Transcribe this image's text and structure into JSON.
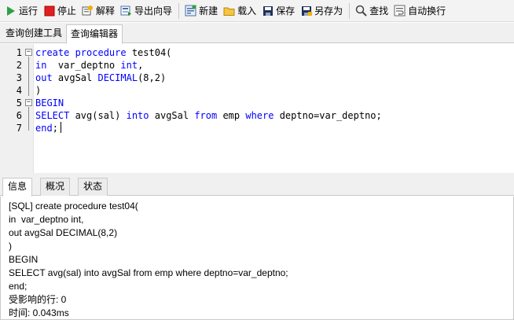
{
  "toolbar": {
    "buttons": [
      {
        "name": "run",
        "label": "运行",
        "icon": "play-icon"
      },
      {
        "name": "stop",
        "label": "停止",
        "icon": "stop-icon"
      },
      {
        "name": "explain",
        "label": "解释",
        "icon": "explain-icon"
      },
      {
        "name": "export-wizard",
        "label": "导出向导",
        "icon": "export-icon"
      },
      {
        "name": "new",
        "label": "新建",
        "icon": "new-icon"
      },
      {
        "name": "load",
        "label": "载入",
        "icon": "folder-icon"
      },
      {
        "name": "save",
        "label": "保存",
        "icon": "save-icon"
      },
      {
        "name": "save-as",
        "label": "另存为",
        "icon": "save-as-icon"
      },
      {
        "name": "find",
        "label": "查找",
        "icon": "search-icon"
      },
      {
        "name": "wrap",
        "label": "自动换行",
        "icon": "wrap-icon"
      }
    ]
  },
  "top_tabs": [
    {
      "label": "查询创建工具",
      "active": false
    },
    {
      "label": "查询编辑器",
      "active": true
    }
  ],
  "editor": {
    "line_numbers": [
      "1",
      "2",
      "3",
      "4",
      "5",
      "6",
      "7"
    ],
    "lines": [
      [
        {
          "t": "create procedure ",
          "k": true
        },
        {
          "t": "test04(",
          "k": false
        }
      ],
      [
        {
          "t": "in",
          "k": true
        },
        {
          "t": "  var_deptno ",
          "k": false
        },
        {
          "t": "int",
          "k": true
        },
        {
          "t": ",",
          "k": false
        }
      ],
      [
        {
          "t": "out",
          "k": true
        },
        {
          "t": " avgSal ",
          "k": false
        },
        {
          "t": "DECIMAL",
          "k": true
        },
        {
          "t": "(8,2)",
          "k": false
        }
      ],
      [
        {
          "t": ")",
          "k": false
        }
      ],
      [
        {
          "t": "BEGIN",
          "k": true
        }
      ],
      [
        {
          "t": "SELECT",
          "k": true
        },
        {
          "t": " avg(sal) ",
          "k": false
        },
        {
          "t": "into",
          "k": true
        },
        {
          "t": " avgSal ",
          "k": false
        },
        {
          "t": "from",
          "k": true
        },
        {
          "t": " emp ",
          "k": false
        },
        {
          "t": "where",
          "k": true
        },
        {
          "t": " deptno=var_deptno;",
          "k": false
        }
      ],
      [
        {
          "t": "end",
          "k": true
        },
        {
          "t": ";",
          "k": false
        }
      ]
    ]
  },
  "bottom_tabs": [
    {
      "label": "信息",
      "active": true
    },
    {
      "label": "概况",
      "active": false
    },
    {
      "label": "状态",
      "active": false
    }
  ],
  "info": {
    "lines": [
      "[SQL] create procedure test04(",
      "in  var_deptno int,",
      "out avgSal DECIMAL(8,2)",
      ")",
      "BEGIN",
      "SELECT avg(sal) into avgSal from emp where deptno=var_deptno;",
      "end;",
      "受影响的行: 0",
      "时间: 0.043ms"
    ]
  },
  "colors": {
    "keyword": "#0000ff",
    "run": "#2ea043",
    "stop": "#e02020"
  }
}
